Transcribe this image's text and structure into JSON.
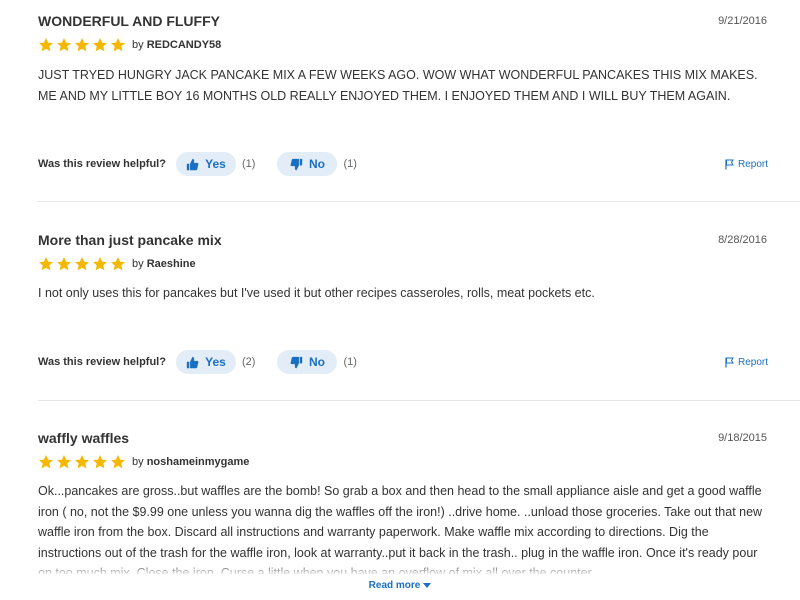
{
  "reviews": [
    {
      "title": "WONDERFUL AND FLUFFY",
      "date": "9/21/2016",
      "rating": 5,
      "by_prefix": "by",
      "author": "REDCANDY58",
      "body": "JUST TRYED HUNGRY JACK PANCAKE MIX A FEW WEEKS AGO. WOW WHAT WONDERFUL PANCAKES THIS MIX MAKES. ME AND MY LITTLE BOY 16 MONTHS OLD REALLY ENJOYED THEM. I ENJOYED THEM AND I WILL BUY THEM AGAIN.",
      "helpful_label": "Was this review helpful?",
      "yes_label": "Yes",
      "yes_count": "(1)",
      "no_label": "No",
      "no_count": "(1)",
      "report_label": "Report"
    },
    {
      "title": "More than just pancake mix",
      "date": "8/28/2016",
      "rating": 5,
      "by_prefix": "by",
      "author": "Raeshine",
      "body": "I not only uses this for pancakes but I've used it but other recipes casseroles, rolls, meat pockets etc.",
      "helpful_label": "Was this review helpful?",
      "yes_label": "Yes",
      "yes_count": "(2)",
      "no_label": "No",
      "no_count": "(1)",
      "report_label": "Report"
    },
    {
      "title": "waffly waffles",
      "date": "9/18/2015",
      "rating": 5,
      "by_prefix": "by",
      "author": "noshameinmygame",
      "body": "Ok...pancakes are gross..but waffles are the bomb! So grab a box and then head to the small appliance aisle and get a good waffle iron ( no, not the $9.99 one unless you wanna dig the waffles off the iron!) ..drive home. ..unload those groceries. Take out that new waffle iron from the box. Discard all instructions and warranty paperwork. Make waffle mix according to directions. Dig the instructions out of the trash for the waffle iron, look at warranty..put it back in the trash.. plug in the waffle iron. Once it's ready pour on too much mix. Close the iron. Curse a little when you have an overflow of mix all over the counter."
    }
  ],
  "read_more_label": "Read more",
  "colors": {
    "star": "#f5b800",
    "accent": "#1a6fc2",
    "button_bg": "#e3edf7"
  },
  "icons": {
    "star": "star-icon",
    "thumbs_up": "thumbs-up-icon",
    "thumbs_down": "thumbs-down-icon",
    "flag": "flag-icon",
    "caret": "chevron-down-icon"
  }
}
